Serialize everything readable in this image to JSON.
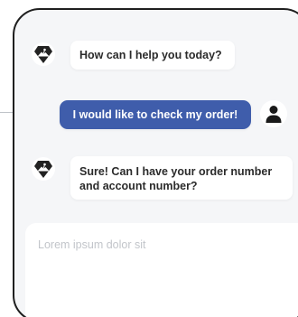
{
  "colors": {
    "frame": "#1f1f1f",
    "background": "#f5f6f8",
    "user_bubble": "#3f5dab",
    "bot_bubble": "#ffffff",
    "placeholder": "#c2c5ca"
  },
  "icons": {
    "bot_avatar": "climber-mountain-logo-icon",
    "user_avatar": "user-silhouette-icon"
  },
  "messages": [
    {
      "sender": "bot",
      "text": "How can I help you today?"
    },
    {
      "sender": "user",
      "text": "I would like to check my order!"
    },
    {
      "sender": "bot",
      "line1": "Sure! Can I have your order number",
      "line2": "and account number?"
    }
  ],
  "composer": {
    "placeholder": "Lorem ipsum dolor sit"
  }
}
